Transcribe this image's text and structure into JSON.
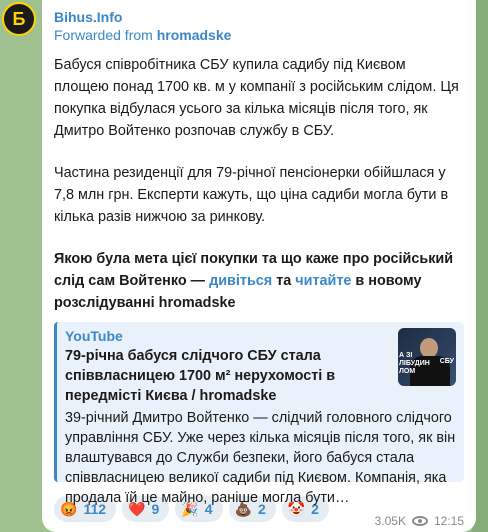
{
  "channel": {
    "name": "Bihus.Info",
    "avatar_letter": "Б"
  },
  "forwarded": {
    "prefix": "Forwarded from",
    "source": "hromadske"
  },
  "message": {
    "p1": "Бабуся співробітника СБУ купила садибу під Києвом площею понад 1700 кв. м у компанії з російським слідом. Ця покупка відбулася усього за кілька місяців після того, як Дмитро Войтенко розпочав службу в СБУ.",
    "p2": "Частина резиденції для 79-річної пенсіонерки обійшлася у 7,8 млн грн. Експерти кажуть, що ціна садиби могла бути в кілька разів нижчою за ринкову.",
    "p3_pre": "Якою була мета цієї покупки та що каже про російський слід сам Войтенко — ",
    "p3_link1": "дивіться",
    "p3_mid": " та ",
    "p3_link2": "читайте",
    "p3_post": " в новому розслідуванні hromadske"
  },
  "preview": {
    "site": "YouTube",
    "title": "79-річна бабуся слідчого СБУ стала співвласницею 1700 м² нерухомості в передмісті Києва / hromadske",
    "description": "39-річний Дмитро Войтенко — слідчий головного слідчого управління СБУ. Уже через кілька місяців після того, як він влаштувався до Служби безпеки, його бабуся стала співвласницею великої садиби під Києвом. Компанія, яка продала їй це майно, раніше могла бути…",
    "thumb_text_left": "А ЗІ\nЛІБУДИН\nЛОМ",
    "thumb_text_right": "СБУ"
  },
  "reactions": [
    {
      "emoji": "😡",
      "icon": "angry-face-icon",
      "count": "112"
    },
    {
      "emoji": "❤️",
      "icon": "heart-icon",
      "count": "9"
    },
    {
      "emoji": "🎉",
      "icon": "party-popper-icon",
      "count": "4"
    },
    {
      "emoji": "💩",
      "icon": "poop-icon",
      "count": "2"
    },
    {
      "emoji": "🤡",
      "icon": "clown-icon",
      "count": "2"
    }
  ],
  "meta": {
    "views": "3.05K",
    "time": "12:15"
  }
}
